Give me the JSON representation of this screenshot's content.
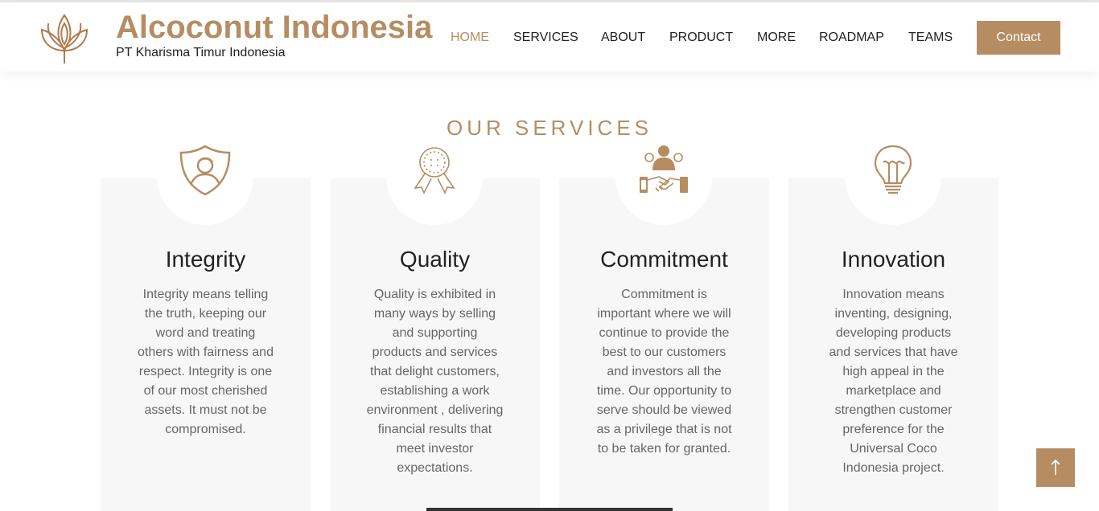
{
  "brand": {
    "title": "Alcoconut Indonesia",
    "subtitle": "PT Kharisma Timur Indonesia"
  },
  "nav": {
    "items": [
      {
        "label": "HOME",
        "active": true
      },
      {
        "label": "SERVICES"
      },
      {
        "label": "ABOUT"
      },
      {
        "label": "PRODUCT"
      },
      {
        "label": "MORE"
      },
      {
        "label": "ROADMAP"
      },
      {
        "label": "TEAMS"
      }
    ],
    "contact_label": "Contact"
  },
  "services": {
    "title": "OUR SERVICES",
    "cards": [
      {
        "icon": "shield-person-icon",
        "title": "Integrity",
        "text": "Integrity means telling the truth, keeping our word and treating others with fairness and respect. Integrity is one of our most cherished assets. It must not be compromised."
      },
      {
        "icon": "award-ribbon-icon",
        "title": "Quality",
        "text": "Quality is exhibited in many ways by selling and supporting products and services that delight customers, establishing a work environment , delivering financial results that meet investor expectations."
      },
      {
        "icon": "handshake-icon",
        "title": "Commitment",
        "text": "Commitment is important where we will continue to provide the best to our customers and investors all the time. Our opportunity to serve should be viewed as a privilege that is not to be taken for granted."
      },
      {
        "icon": "lightbulb-icon",
        "title": "Innovation",
        "text": "Innovation means inventing, designing, developing products and services that have high appeal in the marketplace and strengthen customer preference for the Universal Coco Indonesia project."
      }
    ]
  },
  "colors": {
    "accent": "#b68d62",
    "card_bg": "#f7f7f7",
    "text_dark": "#222222",
    "text_muted": "#666666"
  }
}
